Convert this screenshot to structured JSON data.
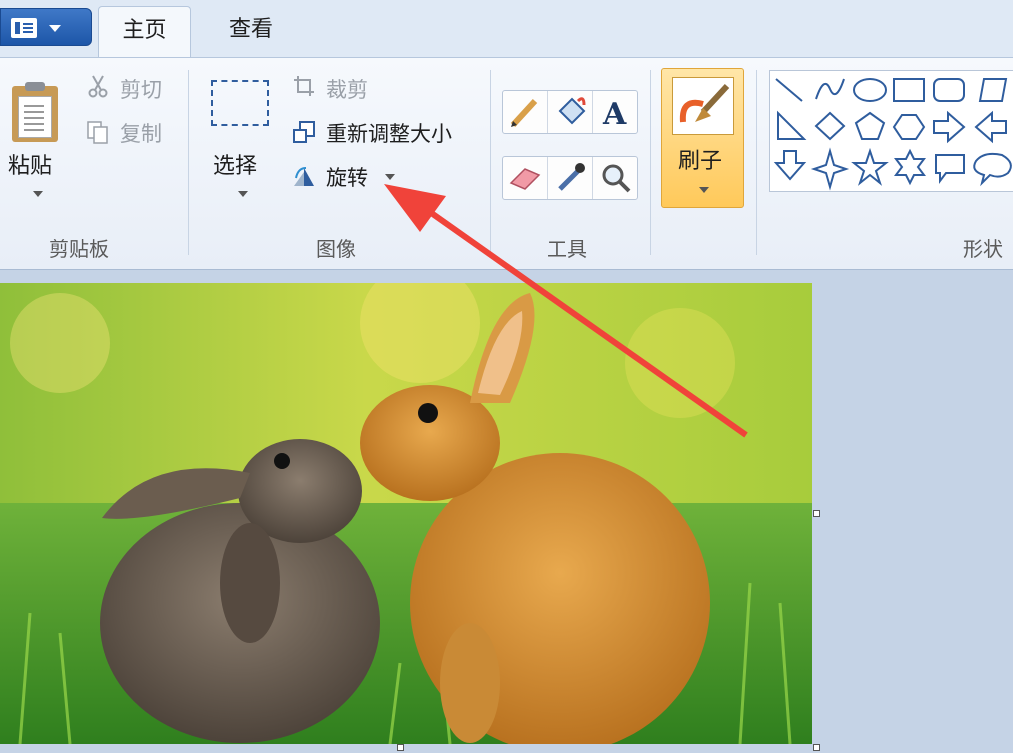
{
  "tabs": {
    "home": "主页",
    "view": "查看"
  },
  "clipboard": {
    "paste": "粘贴",
    "cut": "剪切",
    "copy": "复制",
    "group": "剪贴板"
  },
  "image": {
    "select": "选择",
    "crop": "裁剪",
    "resize": "重新调整大小",
    "rotate": "旋转",
    "group": "图像"
  },
  "tools": {
    "group": "工具",
    "items": [
      "pencil-icon",
      "fill-icon",
      "text-icon",
      "eraser-icon",
      "color-picker-icon",
      "magnifier-icon"
    ]
  },
  "brushes": {
    "label": "刷子"
  },
  "shapes": {
    "group": "形状"
  },
  "colors": {
    "accent": "#2f5d9e",
    "file_button": "#2a5fae",
    "brush_highlight": "#ffc95a",
    "arrow": "#f0433a"
  }
}
